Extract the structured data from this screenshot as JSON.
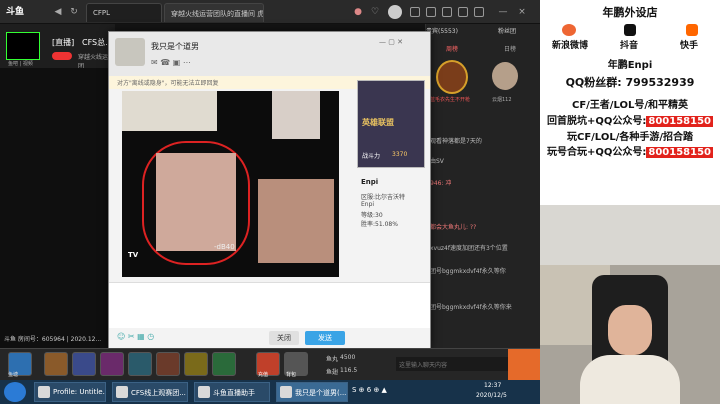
{
  "browser": {
    "logo": "斗鱼",
    "tabs": [
      "CFPL",
      "穿越火线运营团队的直播间 虎"
    ],
    "close": "×"
  },
  "room": {
    "prefix": "[直播]",
    "name": "CFS总...",
    "tag": "穿越火线运营团",
    "room_id": "斗鱼 房间号：605964 | 2020.12...",
    "logo_text": "鱼吧 | 视频"
  },
  "right_panel": {
    "tabs": [
      "贵宾(5553)",
      "粉丝团"
    ],
    "subtabs": [
      "周榜",
      "日榜"
    ],
    "rank1_label": "蓝毛衣先生不开枪",
    "rank2_label": "云烟112",
    "chat": [
      "观看神落都是7天的",
      "由SV",
      "946: 冲",
      "都会大鱼丸儿: ??",
      "xvuz4f速度加团还有3个位置",
      "团号bggmkxdvf4f永久等你",
      "团号bggmkxdvf4f永久等你来"
    ],
    "input_placeholder": "这里输入聊天内容",
    "fish_label": "鱼丸",
    "fish_value": "4500",
    "fin_label": "鱼翅",
    "fin_value": "116.5"
  },
  "qq": {
    "title": "我只是个道男",
    "warning": "对方\"离线或隐身\"，可能无法立即回复",
    "contact_name": "Enpi",
    "contact_region": "区服:比尔吉沃特",
    "contact_id": "Enpi",
    "contact_level": "等级:30",
    "contact_winrate": "胜率:51.08%",
    "game_title": "英雄联盟",
    "power_label": "战斗力",
    "power_value": "3370",
    "photo_caption": "-dB40",
    "photo_tag": "TV",
    "close_btn": "关闭",
    "send_btn": "发送"
  },
  "gamebar": {
    "labels": [
      "鱼塘",
      "充值",
      "背包"
    ]
  },
  "taskbar": {
    "tasks": [
      "Profile: Untitle...",
      "CFS线上观赛团...",
      "斗鱼直播助手",
      "我只是个道男(..."
    ],
    "time": "12:37",
    "date": "2020/12/5"
  },
  "promo": {
    "title": "年鹏外设店",
    "platforms": [
      "新浪微博",
      "抖音",
      "快手"
    ],
    "nick": "年鹏Enpi",
    "qq_fans": "QQ粉丝群: 799532939",
    "line1": "CF/王者/LOL号/和平精英",
    "line2_pre": "回首脱坑+QQ公众号:",
    "line2_num": "800158150",
    "line3": "玩CF/LOL/各种手游/招合踏",
    "line4_pre": "玩号合玩+QQ公众号:",
    "line4_num": "800158150"
  }
}
